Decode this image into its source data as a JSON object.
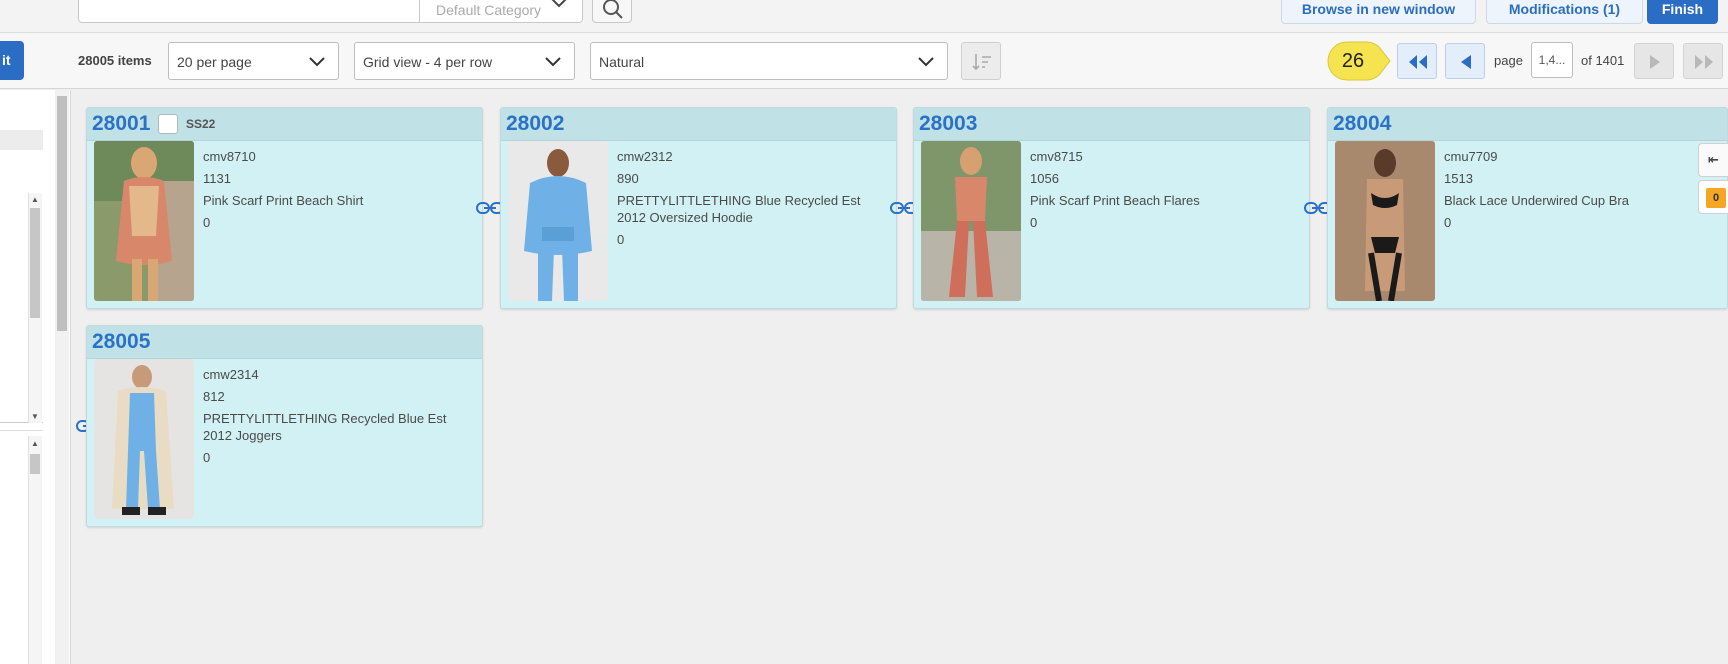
{
  "search": {
    "query": "",
    "category": "Default Category"
  },
  "header": {
    "browse_label": "Browse in new window",
    "modifications_label": "Modifications (1)",
    "finish_label": "Finish"
  },
  "toolbar": {
    "edit_label": "it",
    "items_count": "28005 items",
    "per_page": "20 per page",
    "view_mode": "Grid view - 4 per row",
    "sort": "Natural",
    "annotation_badge": "26",
    "page_label": "page",
    "page_value": "1,4...",
    "of_label": "of 1401"
  },
  "right_tabs": {
    "collapse_label": "⇤",
    "count": "0"
  },
  "products": [
    {
      "id": "28001",
      "tag": "SS22",
      "sku": "cmv8710",
      "qty": "1131",
      "name": "Pink Scarf Print Beach Shirt",
      "extra": "0"
    },
    {
      "id": "28002",
      "tag": "",
      "sku": "cmw2312",
      "qty": "890",
      "name": "PRETTYLITTLETHING Blue Recycled Est 2012 Oversized Hoodie",
      "extra": "0"
    },
    {
      "id": "28003",
      "tag": "",
      "sku": "cmv8715",
      "qty": "1056",
      "name": "Pink Scarf Print Beach Flares",
      "extra": "0"
    },
    {
      "id": "28004",
      "tag": "",
      "sku": "cmu7709",
      "qty": "1513",
      "name": "Black Lace Underwired Cup Bra",
      "extra": "0"
    },
    {
      "id": "28005",
      "tag": "",
      "sku": "cmw2314",
      "qty": "812",
      "name": "PRETTYLITTLETHING Recycled Blue Est 2012 Joggers",
      "extra": "0"
    }
  ],
  "colors": {
    "accent": "#2b6cc4",
    "card_bg": "#d2f1f4",
    "card_header": "#c0e2e7",
    "badge": "#f5e44f",
    "count_badge": "#f5a623"
  }
}
